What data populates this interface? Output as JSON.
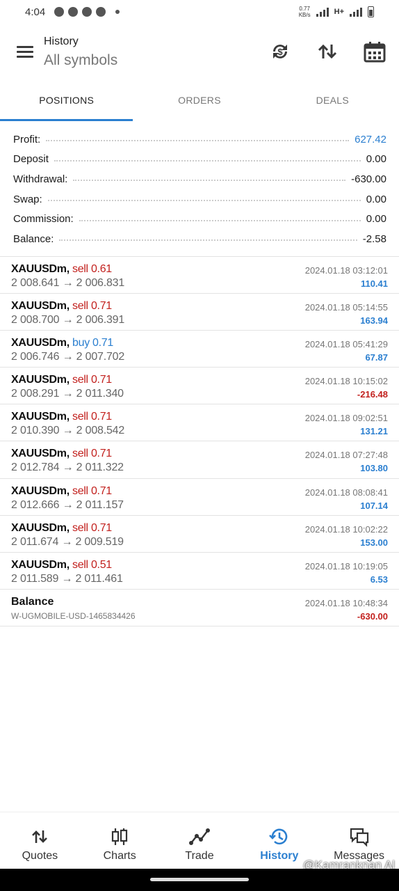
{
  "status_bar": {
    "time": "4:04",
    "speed_value": "0.77",
    "speed_unit": "KB/s",
    "network": "H+"
  },
  "header": {
    "title": "History",
    "subtitle": "All symbols"
  },
  "tabs": [
    {
      "label": "POSITIONS",
      "active": true
    },
    {
      "label": "ORDERS",
      "active": false
    },
    {
      "label": "DEALS",
      "active": false
    }
  ],
  "summary": [
    {
      "label": "Profit:",
      "value": "627.42",
      "highlight": true
    },
    {
      "label": "Deposit",
      "value": "0.00"
    },
    {
      "label": "Withdrawal:",
      "value": "-630.00"
    },
    {
      "label": "Swap:",
      "value": "0.00"
    },
    {
      "label": "Commission:",
      "value": "0.00"
    },
    {
      "label": "Balance:",
      "value": "-2.58"
    }
  ],
  "deals": [
    {
      "symbol": "XAUUSDm,",
      "side": "sell 0.61",
      "type": "sell",
      "prices": "2 008.641 → 2 006.831",
      "date": "2024.01.18 03:12:01",
      "profit": "110.41",
      "sign": "pos"
    },
    {
      "symbol": "XAUUSDm,",
      "side": "sell 0.71",
      "type": "sell",
      "prices": "2 008.700 → 2 006.391",
      "date": "2024.01.18 05:14:55",
      "profit": "163.94",
      "sign": "pos"
    },
    {
      "symbol": "XAUUSDm,",
      "side": "buy 0.71",
      "type": "buy",
      "prices": "2 006.746 → 2 007.702",
      "date": "2024.01.18 05:41:29",
      "profit": "67.87",
      "sign": "pos"
    },
    {
      "symbol": "XAUUSDm,",
      "side": "sell 0.71",
      "type": "sell",
      "prices": "2 008.291 → 2 011.340",
      "date": "2024.01.18 10:15:02",
      "profit": "-216.48",
      "sign": "neg"
    },
    {
      "symbol": "XAUUSDm,",
      "side": "sell 0.71",
      "type": "sell",
      "prices": "2 010.390 → 2 008.542",
      "date": "2024.01.18 09:02:51",
      "profit": "131.21",
      "sign": "pos"
    },
    {
      "symbol": "XAUUSDm,",
      "side": "sell 0.71",
      "type": "sell",
      "prices": "2 012.784 → 2 011.322",
      "date": "2024.01.18 07:27:48",
      "profit": "103.80",
      "sign": "pos"
    },
    {
      "symbol": "XAUUSDm,",
      "side": "sell 0.71",
      "type": "sell",
      "prices": "2 012.666 → 2 011.157",
      "date": "2024.01.18 08:08:41",
      "profit": "107.14",
      "sign": "pos"
    },
    {
      "symbol": "XAUUSDm,",
      "side": "sell 0.71",
      "type": "sell",
      "prices": "2 011.674 → 2 009.519",
      "date": "2024.01.18 10:02:22",
      "profit": "153.00",
      "sign": "pos"
    },
    {
      "symbol": "XAUUSDm,",
      "side": "sell 0.51",
      "type": "sell",
      "prices": "2 011.589 → 2 011.461",
      "date": "2024.01.18 10:19:05",
      "profit": "6.53",
      "sign": "pos"
    }
  ],
  "balance_entry": {
    "title": "Balance",
    "comment": "W-UGMOBILE-USD-1465834426",
    "date": "2024.01.18 10:48:34",
    "amount": "-630.00"
  },
  "bottom_nav": [
    {
      "label": "Quotes",
      "icon": "quotes-arrows-icon",
      "active": false
    },
    {
      "label": "Charts",
      "icon": "candlestick-icon",
      "active": false
    },
    {
      "label": "Trade",
      "icon": "trade-line-icon",
      "active": false
    },
    {
      "label": "History",
      "icon": "history-clock-icon",
      "active": true
    },
    {
      "label": "Messages",
      "icon": "messages-icon",
      "active": false
    }
  ],
  "watermark": "@Kamranknan Al",
  "colors": {
    "accent": "#2b7fd0",
    "loss": "#c2201d"
  }
}
